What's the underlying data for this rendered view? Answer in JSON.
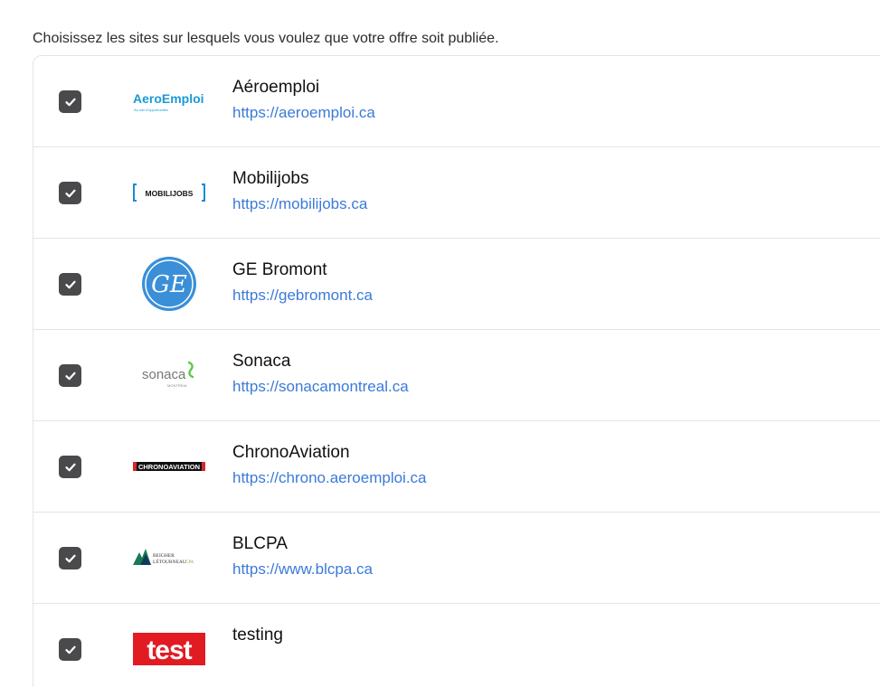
{
  "intro": "Choisissez les sites sur lesquels vous voulez que votre offre soit publiée.",
  "sites": [
    {
      "name": "Aéroemploi",
      "url": "https://aeroemploi.ca",
      "checked": true,
      "logo_text": "AeroEmploi",
      "logo_sub": "Au ciel d'opportunités"
    },
    {
      "name": "Mobilijobs",
      "url": "https://mobilijobs.ca",
      "checked": true,
      "logo_text": "MOBILIJOBS"
    },
    {
      "name": "GE Bromont",
      "url": "https://gebromont.ca",
      "checked": true,
      "logo_text": "GE"
    },
    {
      "name": "Sonaca",
      "url": "https://sonacamontreal.ca",
      "checked": true,
      "logo_text": "sonaca",
      "logo_sub": "MONTRÉAL"
    },
    {
      "name": "ChronoAviation",
      "url": "https://chrono.aeroemploi.ca",
      "checked": true,
      "logo_text": "CHRONOAVIATION"
    },
    {
      "name": "BLCPA",
      "url": "https://www.blcpa.ca",
      "checked": true,
      "logo_text": "BEIGHER LETOURNEAU CPA"
    },
    {
      "name": "testing",
      "url": "",
      "checked": true,
      "logo_text": "test"
    }
  ],
  "colors": {
    "link": "#3b7ad9",
    "checkbox": "#4a4a4c",
    "border": "#e4e4e7",
    "ge_blue": "#3a8fd8",
    "test_red": "#e21b23",
    "sonaca_green": "#5cc84a"
  }
}
